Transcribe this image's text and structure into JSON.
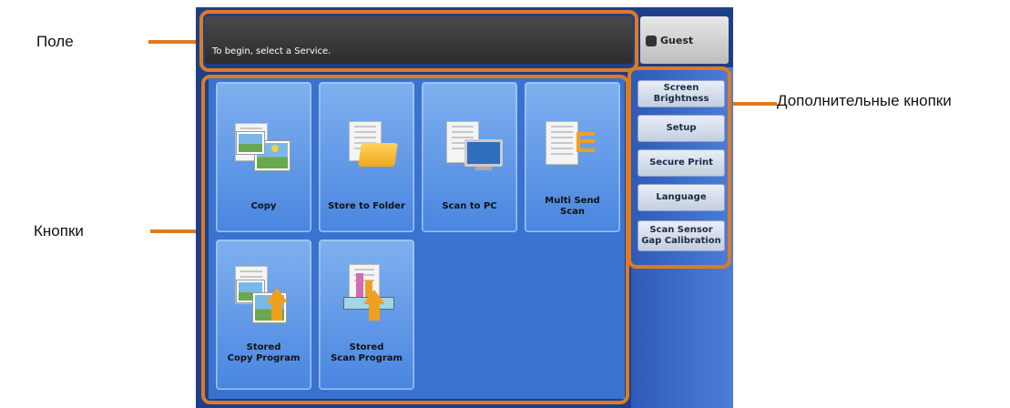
{
  "callouts": {
    "field": "Поле",
    "buttons": "Кнопки",
    "extra_buttons": "Дополнительные кнопки"
  },
  "message_bar": {
    "text": "To begin, select a Service."
  },
  "user": {
    "label": "Guest"
  },
  "services": [
    {
      "label": "Copy",
      "icon": "copy-icon"
    },
    {
      "label": "Store to Folder",
      "icon": "folder-icon"
    },
    {
      "label": "Scan to PC",
      "icon": "computer-icon"
    },
    {
      "label": "Multi Send\nScan",
      "icon": "multi-send-icon"
    },
    {
      "label": "Stored\nCopy Program",
      "icon": "stored-copy-icon"
    },
    {
      "label": "Stored\nScan Program",
      "icon": "stored-scan-icon"
    }
  ],
  "side_buttons": [
    {
      "label": "Screen\nBrightness"
    },
    {
      "label": "Setup"
    },
    {
      "label": "Secure Print"
    },
    {
      "label": "Language"
    },
    {
      "label": "Scan Sensor\nGap Calibration"
    }
  ],
  "colors": {
    "highlight": "#e07a1f",
    "panel": "#3a72cf",
    "tile": "#5c95e6"
  }
}
